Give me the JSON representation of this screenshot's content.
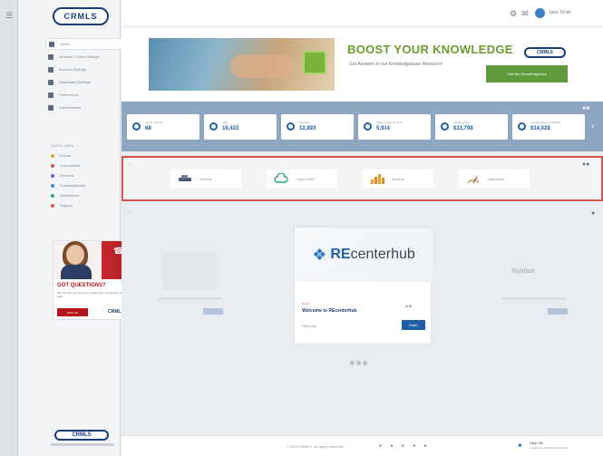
{
  "sidebar": {
    "logo": "CRMLS",
    "nav": [
      {
        "label": "Home",
        "icon": "home-icon",
        "active": true
      },
      {
        "label": "Services / Office Settings",
        "icon": "gear-icon"
      },
      {
        "label": "Account Settings",
        "icon": "user-icon"
      },
      {
        "label": "Dashboard Settings",
        "icon": "dashboard-icon"
      },
      {
        "label": "Preferences",
        "icon": "flag-icon"
      },
      {
        "label": "Subscriptions",
        "icon": "grid-icon"
      }
    ],
    "section_title": "QUICK LINKS",
    "links": [
      {
        "label": "Events",
        "color": "#e8a23a"
      },
      {
        "label": "Connections",
        "color": "#d9534f"
      },
      {
        "label": "Services",
        "color": "#6f5bd0"
      },
      {
        "label": "Knowledgebase",
        "color": "#3c8fd6"
      },
      {
        "label": "Newsletters",
        "color": "#2fa37a"
      },
      {
        "label": "Support",
        "color": "#d9534f"
      }
    ],
    "ad": {
      "headline": "GOT QUESTIONS?",
      "text": "We can help you find your answer fast. Contact the support team.",
      "button": "SIGN UP",
      "logo": "CRMLS"
    },
    "footer_logo": "CRMLS"
  },
  "topbar": {
    "user_name": "Jane Smith"
  },
  "banner": {
    "title": "BOOST YOUR KNOWLEDGE",
    "subtitle": "Got Answers in our Knowledgebase Resource!",
    "logo": "CRMLS",
    "button": "Visit the Knowledgebase"
  },
  "stats": [
    {
      "label": "Active Listings",
      "value": "68"
    },
    {
      "label": "Sold",
      "value": "16,433"
    },
    {
      "label": "Pending",
      "value": "12,893"
    },
    {
      "label": "Active Under Contract",
      "value": "5,914"
    },
    {
      "label": "Median Price",
      "value": "$31,798"
    },
    {
      "label": "Average Days on Market",
      "value": "$14,028"
    }
  ],
  "quick_links": [
    {
      "label": "Flexmls",
      "icon": "car-icon"
    },
    {
      "label": "Cloud CMA",
      "icon": "cloud-icon"
    },
    {
      "label": "Remine",
      "icon": "chart-icon"
    },
    {
      "label": "DataPulse",
      "icon": "gauge-icon"
    }
  ],
  "carousel": {
    "logo_prefix": "RE",
    "logo_suffix": "centerhub",
    "tag": "News",
    "card_title": "Welcome to REcenterhub",
    "site": "View site",
    "button": "Enter",
    "side_name": "Stylebot"
  },
  "footer": {
    "copyright": "© 2023 CRMLS. All rights reserved.",
    "help_title": "Help Me",
    "help_sub": "Contact the CRMLS Help Desk"
  }
}
